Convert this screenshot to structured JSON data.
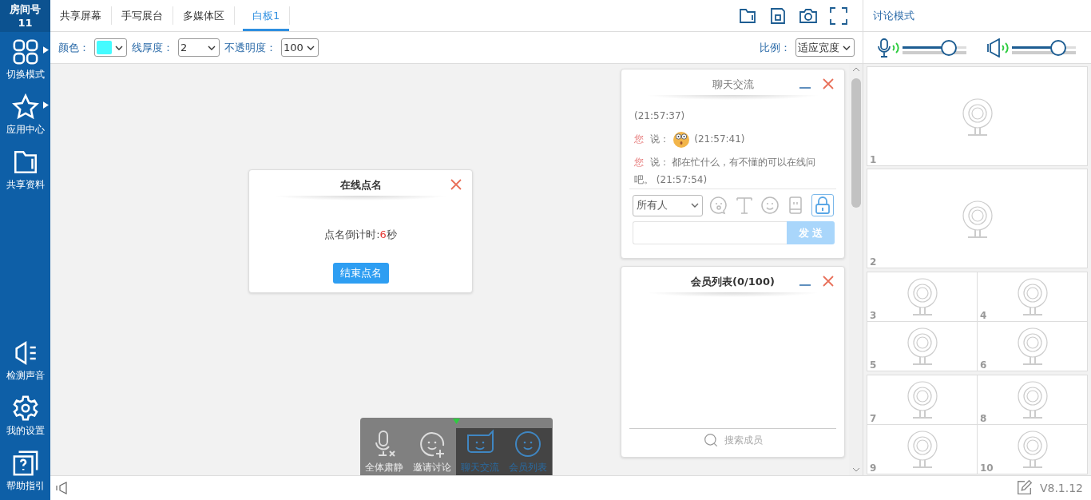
{
  "room": {
    "label": "房间号",
    "number": "11"
  },
  "sidebar": {
    "items": [
      {
        "label": "切换模式",
        "kind": "grid",
        "submenu": true
      },
      {
        "label": "应用中心",
        "kind": "star",
        "submenu": true
      },
      {
        "label": "共享资料",
        "kind": "folder",
        "submenu": false
      }
    ],
    "bottom_items": [
      {
        "label": "检测声音",
        "kind": "speaker"
      },
      {
        "label": "我的设置",
        "kind": "gear"
      },
      {
        "label": "帮助指引",
        "kind": "help"
      }
    ]
  },
  "tabs": [
    {
      "label": "共享屏幕",
      "selected": false
    },
    {
      "label": "手写展台",
      "selected": false
    },
    {
      "label": "多媒体区",
      "selected": false
    },
    {
      "label": "白板1",
      "selected": true
    }
  ],
  "mode": "讨论模式",
  "toolbar": {
    "color_label": "颜色：",
    "color": "#44fbff",
    "thickness_label": "线厚度：",
    "thickness": "2",
    "opacity_label": "不透明度：",
    "opacity": "100",
    "scale_label": "比例：",
    "scale": "适应宽度"
  },
  "audio": {
    "microphone": {
      "level": 0.72
    },
    "speaker": {
      "level": 0.72
    }
  },
  "rollcall": {
    "title": "在线点名",
    "countdown_prefix": "点名倒计时:",
    "countdown_value": "6",
    "countdown_suffix": "秒",
    "button": "结束点名"
  },
  "chat": {
    "title": "聊天交流",
    "messages": [
      {
        "time": "(21:57:37)"
      },
      {
        "sender": "您",
        "said": "说：",
        "emoji": true,
        "time": "(21:57:41)"
      },
      {
        "sender": "您",
        "said": "说：",
        "text": "都在忙什么，有不懂的可以在线问吧。",
        "time": "(21:57:54)"
      }
    ],
    "recipient": "所有人",
    "send": "发 送",
    "locked": true
  },
  "members": {
    "title": "会员列表(0/100)",
    "search_placeholder": "搜索成员"
  },
  "dock": [
    {
      "label": "全体肃静",
      "kind": "mute",
      "active": false
    },
    {
      "label": "邀请讨论",
      "kind": "invite",
      "active": false
    },
    {
      "label": "聊天交流",
      "kind": "chat",
      "active": true
    },
    {
      "label": "会员列表",
      "kind": "members",
      "active": true
    }
  ],
  "videos": [
    {
      "number": "1",
      "kind": "large"
    },
    {
      "number": "2",
      "kind": "large"
    },
    {
      "number": "3",
      "kind": "small"
    },
    {
      "number": "4",
      "kind": "small"
    },
    {
      "number": "5",
      "kind": "small"
    },
    {
      "number": "6",
      "kind": "small"
    },
    {
      "number": "7",
      "kind": "small"
    },
    {
      "number": "8",
      "kind": "small"
    },
    {
      "number": "9",
      "kind": "small"
    },
    {
      "number": "10",
      "kind": "small"
    }
  ],
  "version": "V8.1.12"
}
